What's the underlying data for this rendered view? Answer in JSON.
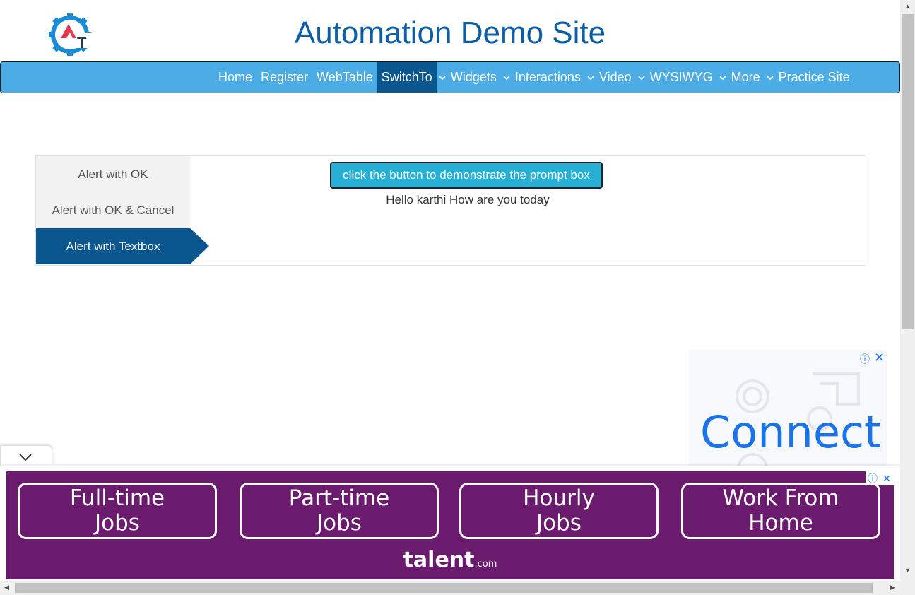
{
  "site": {
    "title": "Automation Demo Site"
  },
  "nav": {
    "home": "Home",
    "register": "Register",
    "webtable": "WebTable",
    "switchto": "SwitchTo",
    "widgets": "Widgets",
    "interactions": "Interactions",
    "video": "Video",
    "wysiwyg": "WYSIWYG",
    "more": "More",
    "practice": "Practice Site"
  },
  "tabs": {
    "ok": "Alert with OK",
    "okcancel": "Alert with OK & Cancel",
    "textbox": "Alert with Textbox"
  },
  "main": {
    "button_label": "click the button to demonstrate the prompt box",
    "result_text": "Hello karthi How are you today"
  },
  "side_ad": {
    "headline": "Connect"
  },
  "bottom_ad": {
    "jobs": [
      "Full-time Jobs",
      "Part-time Jobs",
      "Hourly Jobs",
      "Work From Home"
    ],
    "brand": "talent",
    "brand_suffix": ".com"
  },
  "colors": {
    "nav_bg": "#4cace6",
    "nav_active": "#0a5790",
    "title": "#0d5ea8",
    "button": "#27afd6",
    "ad_purple": "#6a1b6e"
  }
}
